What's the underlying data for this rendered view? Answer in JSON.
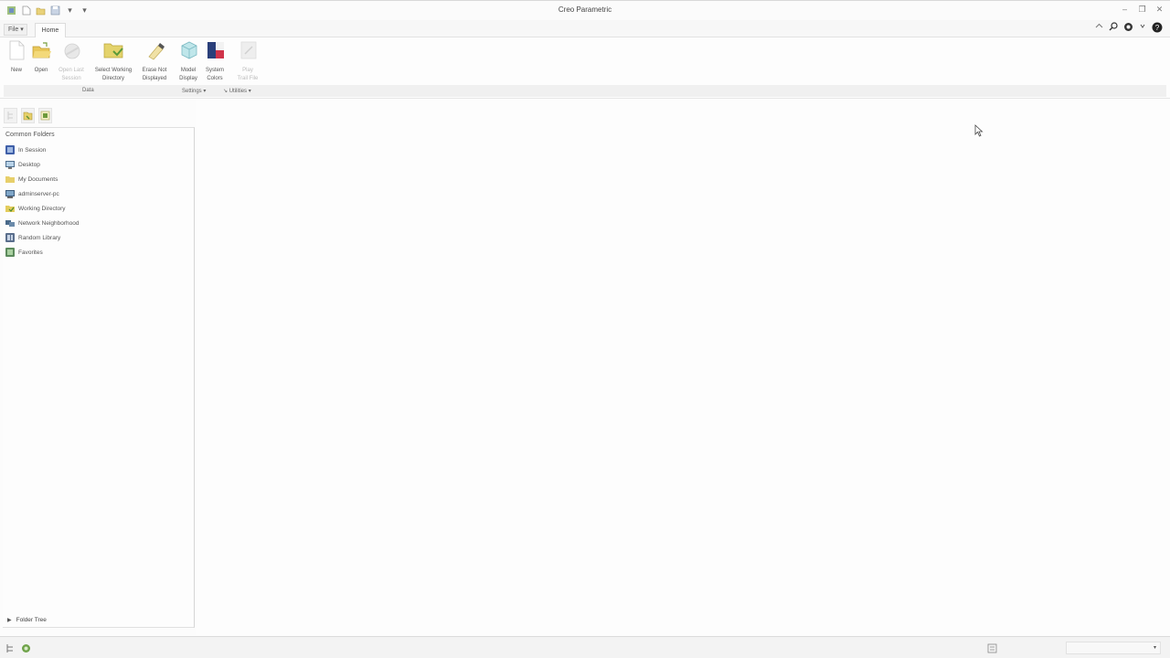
{
  "window": {
    "title": "Creo Parametric"
  },
  "quick_access": [
    {
      "icon": "app-logo-icon"
    },
    {
      "icon": "new-file-icon"
    },
    {
      "icon": "open-file-icon"
    },
    {
      "icon": "save-icon"
    },
    {
      "icon": "dropdown-arrow-icon",
      "glyph": "▾"
    },
    {
      "icon": "customize-icon",
      "glyph": "▾"
    }
  ],
  "window_controls": {
    "minimize": "–",
    "restore": "❐",
    "close": "✕"
  },
  "tabs": {
    "file": "File ▾",
    "home": "Home"
  },
  "top_right": {
    "help": "?"
  },
  "ribbon": {
    "buttons": [
      {
        "label": "New",
        "disabled": false
      },
      {
        "label": "Open",
        "disabled": false
      },
      {
        "label": "Open Last\nSession",
        "disabled": true
      },
      {
        "label": "Select Working\nDirectory",
        "disabled": false
      },
      {
        "label": "Erase Not\nDisplayed",
        "disabled": false
      },
      {
        "label": "Model\nDisplay",
        "disabled": false
      },
      {
        "label": "System\nColors",
        "disabled": false
      },
      {
        "label": "Play\nTrail File",
        "disabled": true
      }
    ],
    "groups": {
      "data": "Data",
      "settings": "Settings ▾",
      "utilities": "Utilities ▾"
    }
  },
  "navigator": {
    "header": "Common Folders",
    "items": [
      {
        "label": "In Session",
        "icon": "in-session-icon"
      },
      {
        "label": "Desktop",
        "icon": "desktop-icon"
      },
      {
        "label": "My Documents",
        "icon": "my-documents-icon"
      },
      {
        "label": "adminserver-pc",
        "icon": "computer-icon"
      },
      {
        "label": "Working Directory",
        "icon": "working-directory-icon"
      },
      {
        "label": "Network Neighborhood",
        "icon": "network-icon"
      },
      {
        "label": "Random Library",
        "icon": "library-icon"
      },
      {
        "label": "Favorites",
        "icon": "favorites-icon"
      }
    ],
    "folder_tree": "Folder Tree"
  },
  "status": {
    "select_value": "▾"
  }
}
